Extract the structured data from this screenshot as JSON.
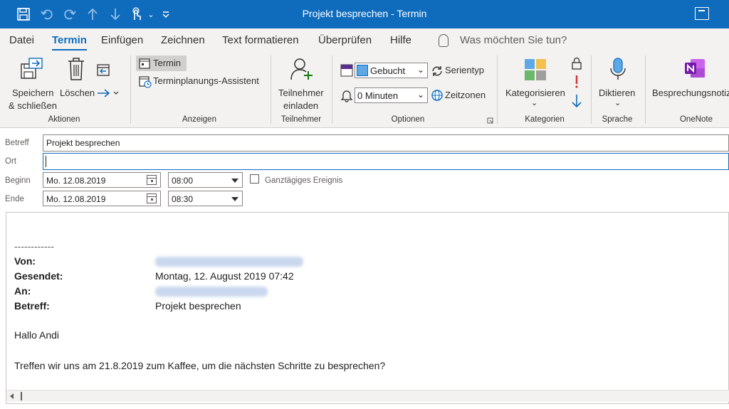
{
  "window": {
    "title": "Projekt besprechen  -  Termin"
  },
  "menu": {
    "tabs": [
      "Datei",
      "Termin",
      "Einfügen",
      "Zeichnen",
      "Text formatieren",
      "Überprüfen",
      "Hilfe"
    ],
    "active_tab": "Termin",
    "tell_me": "Was möchten Sie tun?"
  },
  "ribbon": {
    "aktionen": {
      "label": "Aktionen",
      "save_close_line1": "Speichern",
      "save_close_line2": "& schließen",
      "delete": "Löschen"
    },
    "anzeigen": {
      "label": "Anzeigen",
      "termin": "Termin",
      "assistent": "Terminplanungs-Assistent"
    },
    "teilnehmer": {
      "label": "Teilnehmer",
      "invite_line1": "Teilnehmer",
      "invite_line2": "einladen"
    },
    "optionen": {
      "label": "Optionen",
      "show_as": "Gebucht",
      "reminder": "0 Minuten",
      "recurrence": "Serientyp",
      "time_zones": "Zeitzonen"
    },
    "kategorien": {
      "label": "Kategorien",
      "categorize": "Kategorisieren"
    },
    "sprache": {
      "label": "Sprache",
      "dictate": "Diktieren"
    },
    "onenote": {
      "label": "OneNote",
      "notes": "Besprechungsnotiz"
    }
  },
  "form": {
    "subject_label": "Betreff",
    "subject_value": "Projekt besprechen",
    "location_label": "Ort",
    "location_value": "",
    "start_label": "Beginn",
    "start_date": "Mo. 12.08.2019",
    "start_time": "08:00",
    "allday_label": "Ganztägiges Ereignis",
    "end_label": "Ende",
    "end_date": "Mo. 12.08.2019",
    "end_time": "08:30"
  },
  "body": {
    "separator": "------------",
    "from_label": "Von:",
    "sent_label": "Gesendet:",
    "sent_value": "Montag, 12. August 2019 07:42",
    "to_label": "An:",
    "subject_label": "Betreff:",
    "subject_value": "Projekt besprechen",
    "greeting": "Hallo Andi",
    "message": "Treffen wir uns am 21.8.2019 zum Kaffee, um die nächsten Schritte zu besprechen?"
  },
  "colors": {
    "accent": "#0f6cbd",
    "ribbon_bg": "#f3f2f1",
    "importance_red": "#d13438",
    "onenote_purple": "#7719aa"
  }
}
